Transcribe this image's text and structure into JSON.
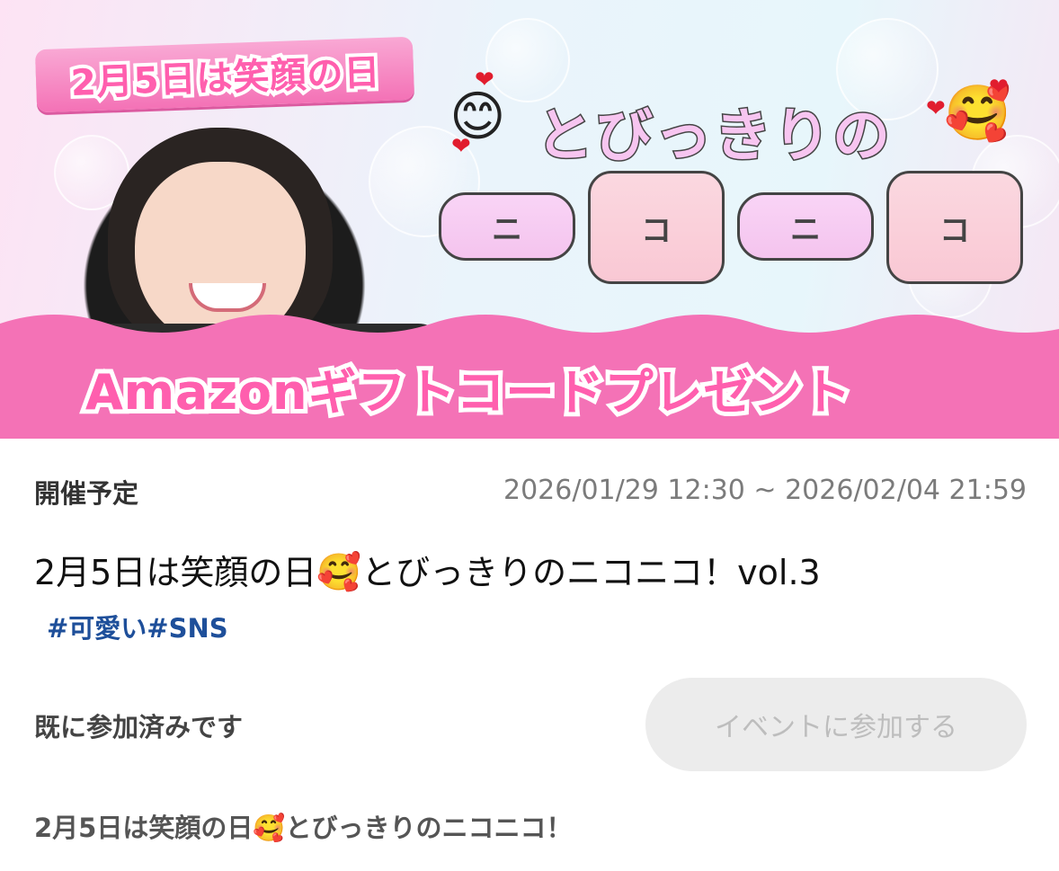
{
  "banner": {
    "ribbon_text": "2月5日は笑顔の日",
    "headline_top": "とびっきりの",
    "headline_main": [
      "ニ",
      "コ",
      "ニ",
      "コ"
    ],
    "gift_text": "Amazonギフトコードプレゼント",
    "emoji_left": "😊",
    "emoji_right": "🥰",
    "heart": "❤",
    "colors": {
      "accent_pink": "#ff5fae",
      "band_pink": "#f472b6"
    }
  },
  "event": {
    "status": "開催予定",
    "period": "2026/01/29 12:30 ~ 2026/02/04 21:59",
    "title_before": "2月5日は笑顔の日",
    "title_emoji": "🥰",
    "title_after": "とびっきりのニコニコ！vol.3",
    "tags": "#可愛い#SNS",
    "joined_text": "既に参加済みです",
    "join_button": "イベントに参加する",
    "desc_before": "2月5日は笑顔の日",
    "desc_emoji": "🥰",
    "desc_after": "とびっきりのニコニコ！"
  }
}
